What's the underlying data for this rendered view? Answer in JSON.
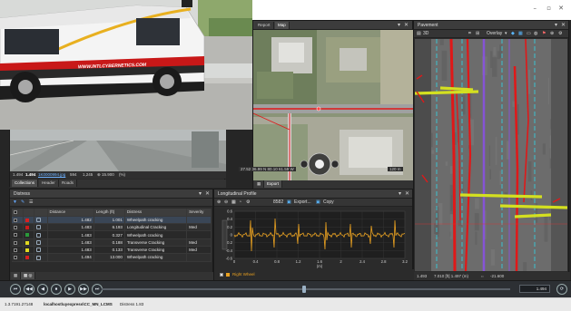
{
  "photo": {
    "van_text": "WWW.INTLCYBERNETICS.COM"
  },
  "image_viewer": {
    "status_left": "1.494",
    "status_bold": "1.494",
    "status_file": "1K0000994.jpg",
    "status_idx": "594",
    "status_total": "1,245",
    "status_zoom": "⊕ 15.900",
    "status_pct": "(%)",
    "tabs": [
      "Collections",
      "Header",
      "Roads"
    ]
  },
  "map": {
    "tabs": [
      "Report",
      "Map"
    ],
    "coords": "27.52 36.99 N 80.10 61.59 W",
    "scale": "120 m",
    "bottom_tabs": [
      "Export"
    ]
  },
  "pavement": {
    "title": "Pavement",
    "toolbar": [
      "3D",
      "Overlay"
    ],
    "status_left": "1.493",
    "status_mid": "7.010 [ft] 1.497 (m)",
    "status_right": "-21.600"
  },
  "distress": {
    "title": "Distress",
    "columns": [
      "Distance",
      "Length (ft)",
      "Distress",
      "Severity"
    ],
    "rows": [
      {
        "swatch": "#d82020",
        "distance": "1.482",
        "length": "1.001",
        "distress": "Wheelpath cracking",
        "severity": ""
      },
      {
        "swatch": "#cc1a1a",
        "distance": "1.483",
        "length": "6.193",
        "distress": "Longitudinal Cracking",
        "severity": "Med"
      },
      {
        "swatch": "#2a9a3a",
        "distance": "1.483",
        "length": "0.327",
        "distress": "Wheelpath cracking",
        "severity": ""
      },
      {
        "swatch": "#e0d820",
        "distance": "1.483",
        "length": "0.188",
        "distress": "Transverse Cracking",
        "severity": "Med"
      },
      {
        "swatch": "#e0d820",
        "distance": "1.483",
        "length": "0.133",
        "distress": "Transverse Cracking",
        "severity": "Med"
      },
      {
        "swatch": "#d82020",
        "distance": "1.494",
        "length": "13.000",
        "distress": "Wheelpath cracking",
        "severity": ""
      }
    ]
  },
  "profile": {
    "title": "Longitudinal Profile",
    "toolbar": [
      "8582",
      "Export...",
      "Copy"
    ],
    "y_ticks": [
      "0.6",
      "0.4",
      "0.2",
      "0",
      "-0.2",
      "-0.4",
      "-0.6"
    ],
    "x_ticks": [
      "0",
      "0.4",
      "0.8",
      "1.2",
      "1.6",
      "2",
      "2.4",
      "2.8",
      "3.2"
    ],
    "x_unit": "(m)",
    "legend": "Right Wheel",
    "line_color": "#e8a020"
  },
  "player": {
    "buttons": [
      "⏮",
      "◀◀",
      "◀",
      "⏹",
      "▶",
      "▶▶",
      "⏭"
    ],
    "position": "1.494"
  },
  "statusbar": {
    "version": "1.3.7191.27148",
    "path": "localhost\\uyexpress\\CC_MN_LCMS",
    "layer": "Distress 1.83"
  },
  "colors": {
    "crack_red": "#e01818",
    "crack_yellow": "#d4e020",
    "lane_cyan": "#30d8e8",
    "lane_purple": "#8a50e8",
    "accent_orange": "#e8a020"
  }
}
